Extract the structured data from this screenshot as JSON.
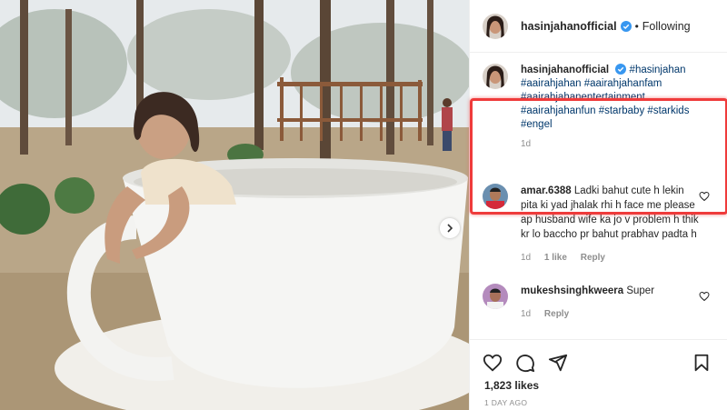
{
  "post": {
    "username": "hasinjahanofficial",
    "follow_status": "Following",
    "separator": "•",
    "caption_tags": [
      "#hasinjahan",
      "#aairahjahan",
      "#aairahjahanfam",
      "#aairahjahanentertainment",
      "#aairahjahanfun",
      "#starbaby",
      "#starkids",
      "#engel"
    ],
    "caption_age": "1d",
    "likes": "1,823 likes",
    "posted": "1 DAY AGO"
  },
  "comments": [
    {
      "username": "amar.6388",
      "text": "Ladki bahut cute h lekin pita ki yad jhalak rhi h face me please ap husband wife ka jo v problem h thik kr lo baccho pr bahut prabhav padta h",
      "age": "1d",
      "likes": "1 like",
      "reply": "Reply"
    },
    {
      "username": "mukeshsinghkweera",
      "text": "Super",
      "age": "1d",
      "reply": "Reply"
    }
  ],
  "icons": {
    "verified": "verified-badge-icon",
    "like": "heart-icon",
    "comment": "comment-bubble-icon",
    "share": "paper-plane-icon",
    "save": "bookmark-icon",
    "next": "chevron-right-icon"
  },
  "colors": {
    "link": "#00376b",
    "verified": "#3897f0",
    "highlight": "#ef3b3b",
    "muted": "#8e8e8e"
  }
}
